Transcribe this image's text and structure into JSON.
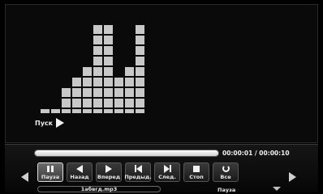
{
  "visualizer": {
    "levels": [
      1,
      1,
      3,
      4,
      5,
      9,
      9,
      4,
      5,
      9
    ]
  },
  "status_overlay": {
    "label": "Пуск",
    "icon": "play-icon"
  },
  "progress": {
    "elapsed_fraction": 1.0,
    "time_label": "00:00:01 / 00:00:10"
  },
  "controls": {
    "left_arrow_icon": "left-arrow-icon",
    "right_arrow_icon": "right-arrow-icon",
    "buttons": [
      {
        "label": "Пауза",
        "icon": "pause-icon",
        "active": true
      },
      {
        "label": "Назад",
        "icon": "rewind-icon"
      },
      {
        "label": "Вперед",
        "icon": "fast-forward-icon"
      },
      {
        "label": "Предыд.",
        "icon": "skip-previous-icon"
      },
      {
        "label": "След.",
        "icon": "skip-next-icon"
      },
      {
        "label": "Стоп",
        "icon": "stop-icon"
      },
      {
        "label": "Все",
        "icon": "repeat-all-icon"
      }
    ]
  },
  "footer": {
    "filename": "1абвгд.mp3",
    "state_text": "Пауза",
    "down_icon": "down-arrow-icon"
  },
  "colors": {
    "background": "#000000",
    "cell": "#c8c8c8",
    "active_border": "#dcdcdc"
  }
}
